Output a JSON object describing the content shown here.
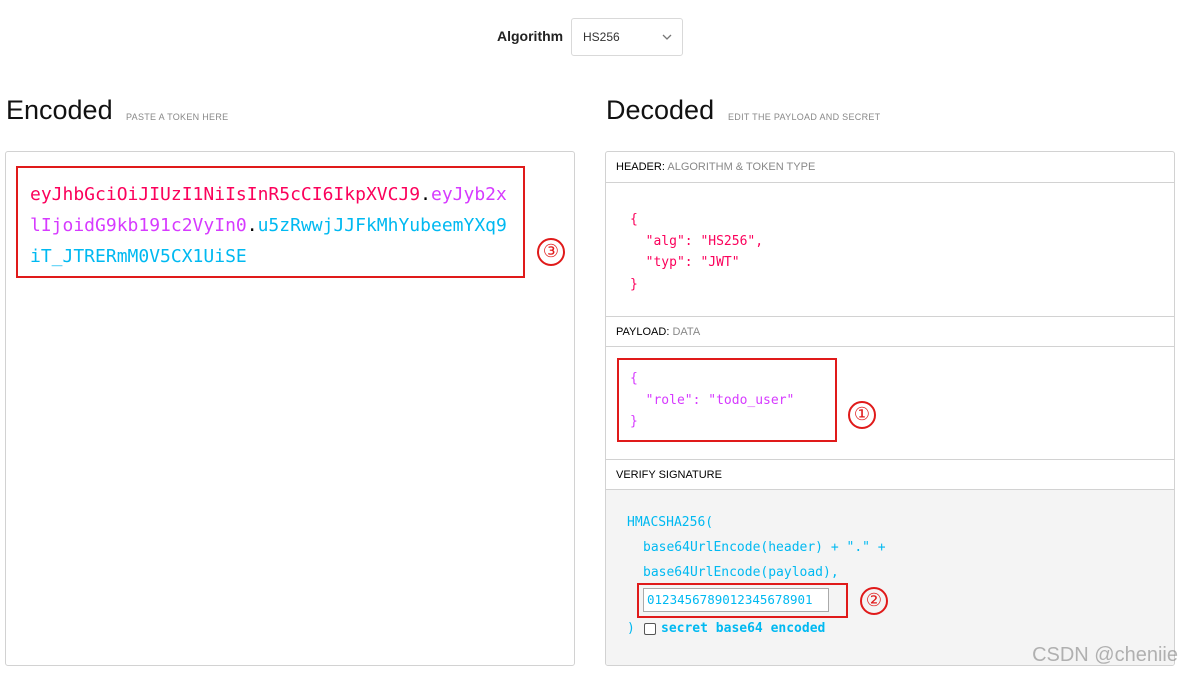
{
  "algorithm": {
    "label": "Algorithm",
    "selected": "HS256"
  },
  "encoded": {
    "title": "Encoded",
    "subtitle": "PASTE A TOKEN HERE",
    "token_header": "eyJhbGciOiJIUzI1NiIsInR5cCI6IkpXVCJ9",
    "dot1": ".",
    "token_payload": "eyJyb2xlIjoidG9kb191c2VyIn0",
    "dot2": ".",
    "token_signature": "u5zRwwjJJFkMhYubeemYXq9iT_JTRERmM0V5CX1UiSE"
  },
  "decoded": {
    "title": "Decoded",
    "subtitle": "EDIT THE PAYLOAD AND SECRET",
    "header_section": {
      "label": "HEADER:",
      "muted": "ALGORITHM & TOKEN TYPE"
    },
    "header_json": "{\n  \"alg\": \"HS256\",\n  \"typ\": \"JWT\"\n}",
    "payload_section": {
      "label": "PAYLOAD:",
      "muted": "DATA"
    },
    "payload_json": "{\n  \"role\": \"todo_user\"\n}",
    "signature_section": {
      "label": "VERIFY SIGNATURE"
    },
    "sig_line1": "HMACSHA256(",
    "sig_line2": "base64UrlEncode(header) + \".\" +",
    "sig_line3": "base64UrlEncode(payload),",
    "secret_value": "0123456789012345678901",
    "sig_close": ")",
    "secret_b64_label": "secret base64 encoded"
  },
  "annotations": {
    "marker_1": "①",
    "marker_2": "②",
    "marker_3": "③"
  },
  "watermark": "CSDN @cheniie",
  "colors": {
    "header": "#fb015b",
    "payload": "#d63aff",
    "signature": "#00b9f1",
    "annotation": "#e01a1a"
  }
}
